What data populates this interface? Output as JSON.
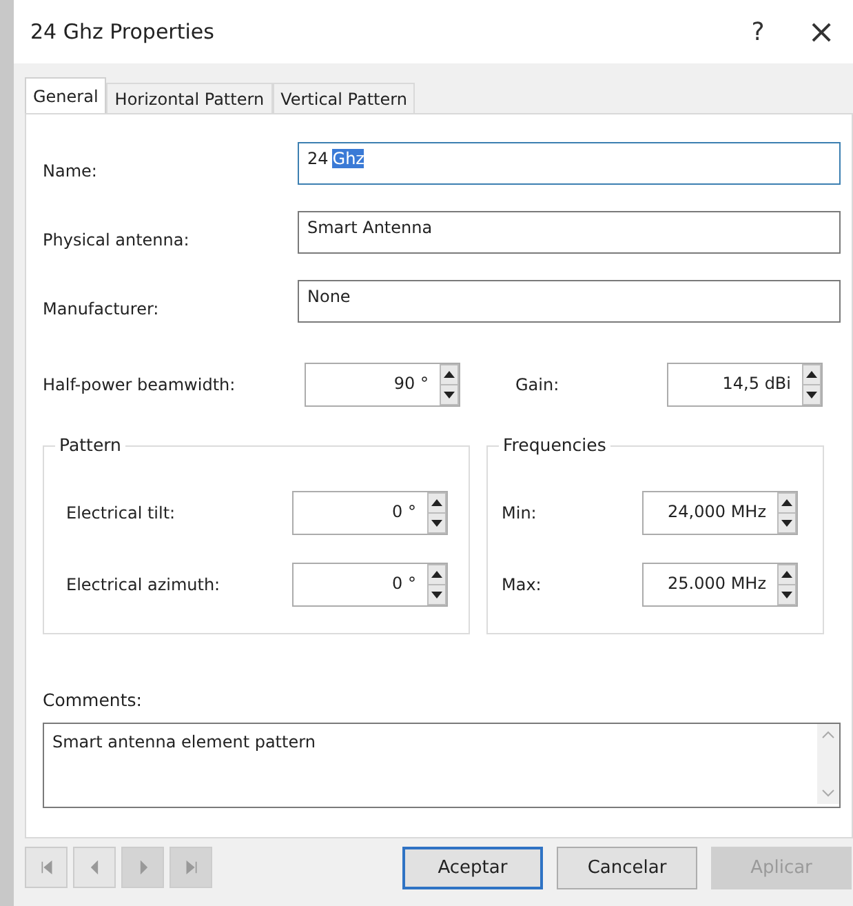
{
  "window": {
    "title": "24 Ghz Properties",
    "help": "?",
    "close": "×"
  },
  "tabs": [
    {
      "label": "General",
      "selected": true
    },
    {
      "label": "Horizontal Pattern",
      "selected": false
    },
    {
      "label": "Vertical Pattern",
      "selected": false
    }
  ],
  "fields": [
    {
      "label": "Name:",
      "value": "24",
      "selection": "Ghz",
      "focused": true
    },
    {
      "label": "Physical antenna:",
      "value": "Smart Antenna",
      "focused": false
    },
    {
      "label": "Manufacturer:",
      "value": "None",
      "focused": false
    }
  ],
  "beamwidth": {
    "label": "Half-power beamwidth:",
    "value": "90 °"
  },
  "gain": {
    "label": "Gain:",
    "value": "14,5  dBi"
  },
  "pattern": {
    "title": "Pattern",
    "rows": [
      {
        "label": "Electrical tilt:",
        "value": "0 °"
      },
      {
        "label": "Electrical azimuth:",
        "value": "0 °"
      }
    ]
  },
  "frequencies": {
    "title": "Frequencies",
    "rows": [
      {
        "label": "Min:",
        "value": "24,000  MHz"
      },
      {
        "label": "Max:",
        "value": "25.000 MHz"
      }
    ]
  },
  "comments": {
    "label": "Comments:",
    "value": "Smart antenna element pattern"
  },
  "nav_buttons": [
    {
      "kind": "first",
      "disabled": false
    },
    {
      "kind": "prev",
      "disabled": false
    },
    {
      "kind": "next",
      "disabled": true
    },
    {
      "kind": "last",
      "disabled": true
    }
  ],
  "buttons": [
    {
      "label": "Aceptar",
      "default": true,
      "disabled": false
    },
    {
      "label": "Cancelar",
      "default": false,
      "disabled": false
    },
    {
      "label": "Aplicar",
      "default": false,
      "disabled": true
    }
  ]
}
